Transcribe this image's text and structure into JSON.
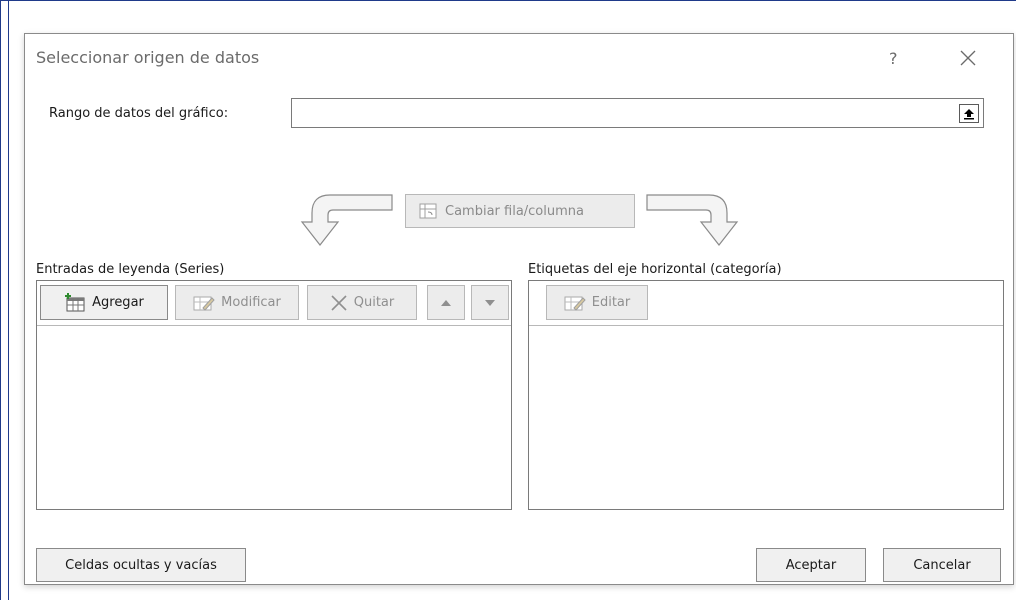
{
  "dialog": {
    "title": "Seleccionar origen de datos",
    "help": "?",
    "range_label": "Rango de datos del gráfico:",
    "range_value": "",
    "switch_label": "Cambiar fila/columna"
  },
  "legend_panel": {
    "label": "Entradas de leyenda (Series)",
    "buttons": {
      "add": "Agregar",
      "edit": "Modificar",
      "remove": "Quitar"
    },
    "items": []
  },
  "axis_panel": {
    "label": "Etiquetas del eje horizontal (categoría)",
    "buttons": {
      "edit": "Editar"
    },
    "items": []
  },
  "footer": {
    "hidden_cells": "Celdas ocultas y vacías",
    "ok": "Aceptar",
    "cancel": "Cancelar"
  },
  "icons": [
    "close-icon",
    "collapse-dialog-icon",
    "arrow-curve-left-icon",
    "arrow-curve-right-icon",
    "switch-row-column-icon",
    "add-series-icon",
    "edit-series-icon",
    "remove-series-icon",
    "move-up-icon",
    "move-down-icon",
    "edit-axis-icon"
  ],
  "colors": {
    "window_border": "#1f3a8a",
    "disabled_text": "#8f8f8f",
    "button_bg": "#f0f0f0"
  }
}
